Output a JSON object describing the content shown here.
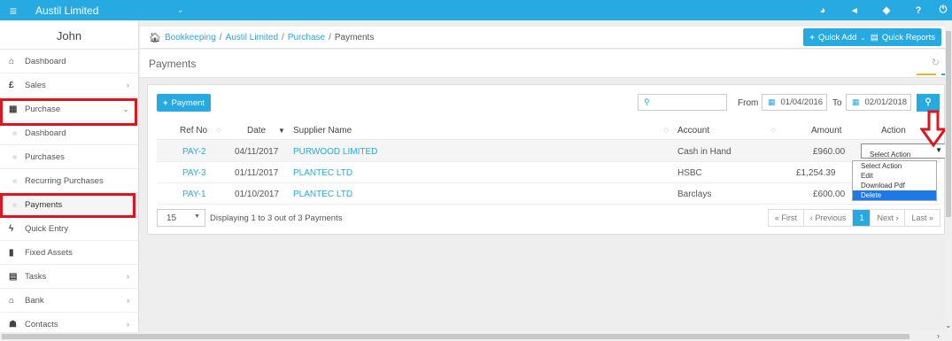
{
  "topbar": {
    "menu_icon": "hamburger-icon",
    "company": "Austil Limited",
    "company_caret": "⌄",
    "icons": [
      "help-circle-icon",
      "megaphone-icon",
      "tag-icon",
      "question-icon",
      "power-icon"
    ]
  },
  "sidebar": {
    "user": "John",
    "items": [
      {
        "label": "Dashboard",
        "icon": "home-icon"
      },
      {
        "label": "Sales",
        "icon": "pound-icon"
      },
      {
        "label": "Purchase",
        "icon": "purchase-icon"
      },
      {
        "label": "Dashboard",
        "icon": ""
      },
      {
        "label": "Purchases",
        "icon": ""
      },
      {
        "label": "Recurring Purchases",
        "icon": ""
      },
      {
        "label": "Payments",
        "icon": ""
      },
      {
        "label": "Quick Entry",
        "icon": "bolt-icon"
      },
      {
        "label": "Fixed Assets",
        "icon": "building-icon"
      },
      {
        "label": "Tasks",
        "icon": "tasks-icon"
      },
      {
        "label": "Bank",
        "icon": "bank-icon"
      },
      {
        "label": "Contacts",
        "icon": "contacts-icon"
      }
    ]
  },
  "breadcrumb": {
    "items": [
      "Bookkeeping",
      "Austil Limited",
      "Purchase"
    ],
    "current": "Payments",
    "separator": "/"
  },
  "header_buttons": {
    "quick_add": "Quick Add",
    "quick_reports": "Quick Reports"
  },
  "page": {
    "title": "Payments"
  },
  "toolbar": {
    "add_payment": "Payment",
    "search_placeholder": "",
    "from_label": "From",
    "from_date": "01/04/2016",
    "to_label": "To",
    "to_date": "02/01/2018"
  },
  "table": {
    "headers": {
      "ref_no": "Ref No",
      "date": "Date",
      "supplier": "Supplier Name",
      "account": "Account",
      "amount": "Amount",
      "action": "Action"
    },
    "rows": [
      {
        "ref": "PAY-2",
        "date": "04/11/2017",
        "supplier": "PURWOOD LIMITED",
        "account": "Cash in Hand",
        "amount": "£960.00"
      },
      {
        "ref": "PAY-3",
        "date": "01/11/2017",
        "supplier": "PLANTEC LTD",
        "account": "HSBC",
        "amount": "£1,254.39"
      },
      {
        "ref": "PAY-1",
        "date": "01/10/2017",
        "supplier": "PLANTEC LTD",
        "account": "Barclays",
        "amount": "£600.00"
      }
    ]
  },
  "action_select": {
    "value": "Select Action",
    "options": [
      "Select Action",
      "Edit",
      "Download Pdf",
      "Delete"
    ],
    "highlighted": "Delete"
  },
  "pagination": {
    "page_size": "15",
    "display_text": "Displaying 1 to 3 out of 3 Payments",
    "first": "« First",
    "previous": "‹ Previous",
    "current_page": "1",
    "next": "Next ›",
    "last": "Last »"
  },
  "colors": {
    "accent": "#27a9e1",
    "highlight": "#e0141e",
    "dropdown_selected": "#1e79e8"
  }
}
